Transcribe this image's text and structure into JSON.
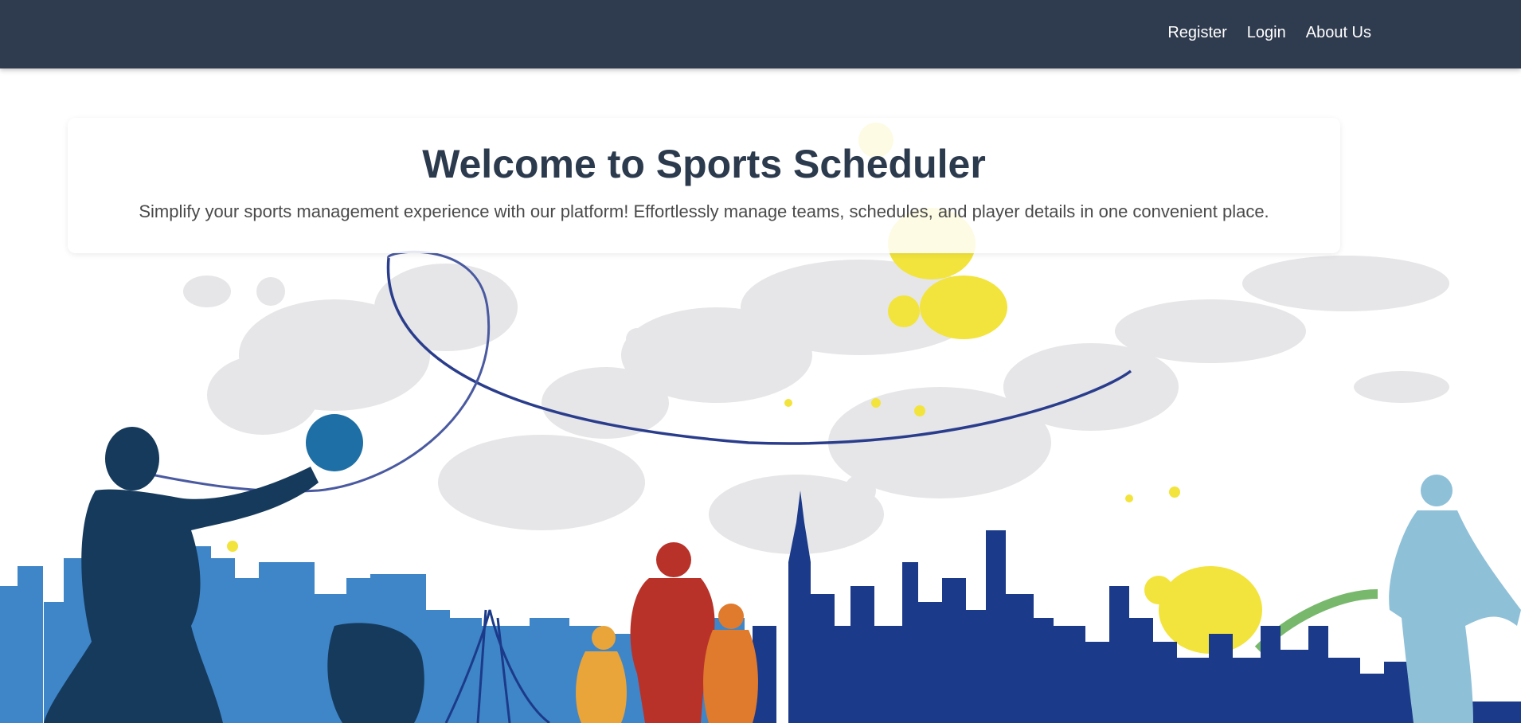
{
  "nav": {
    "links": [
      {
        "label": "Register"
      },
      {
        "label": "Login"
      },
      {
        "label": "About Us"
      }
    ]
  },
  "hero": {
    "title": "Welcome to Sports Scheduler",
    "subtitle": "Simplify your sports management experience with our platform! Effortlessly manage teams, schedules, and player details in one convenient place."
  },
  "colors": {
    "navbar": "#2f3b4e",
    "title": "#2c3a4d",
    "skyline_dark": "#1c3a8a",
    "skyline_light": "#3f86c9",
    "splash_yellow": "#f2e43c",
    "runner_red": "#b8322a",
    "runner_orange": "#e07a2c",
    "runner_gold": "#e9a43a",
    "runner_light_blue": "#8ec0d8"
  }
}
